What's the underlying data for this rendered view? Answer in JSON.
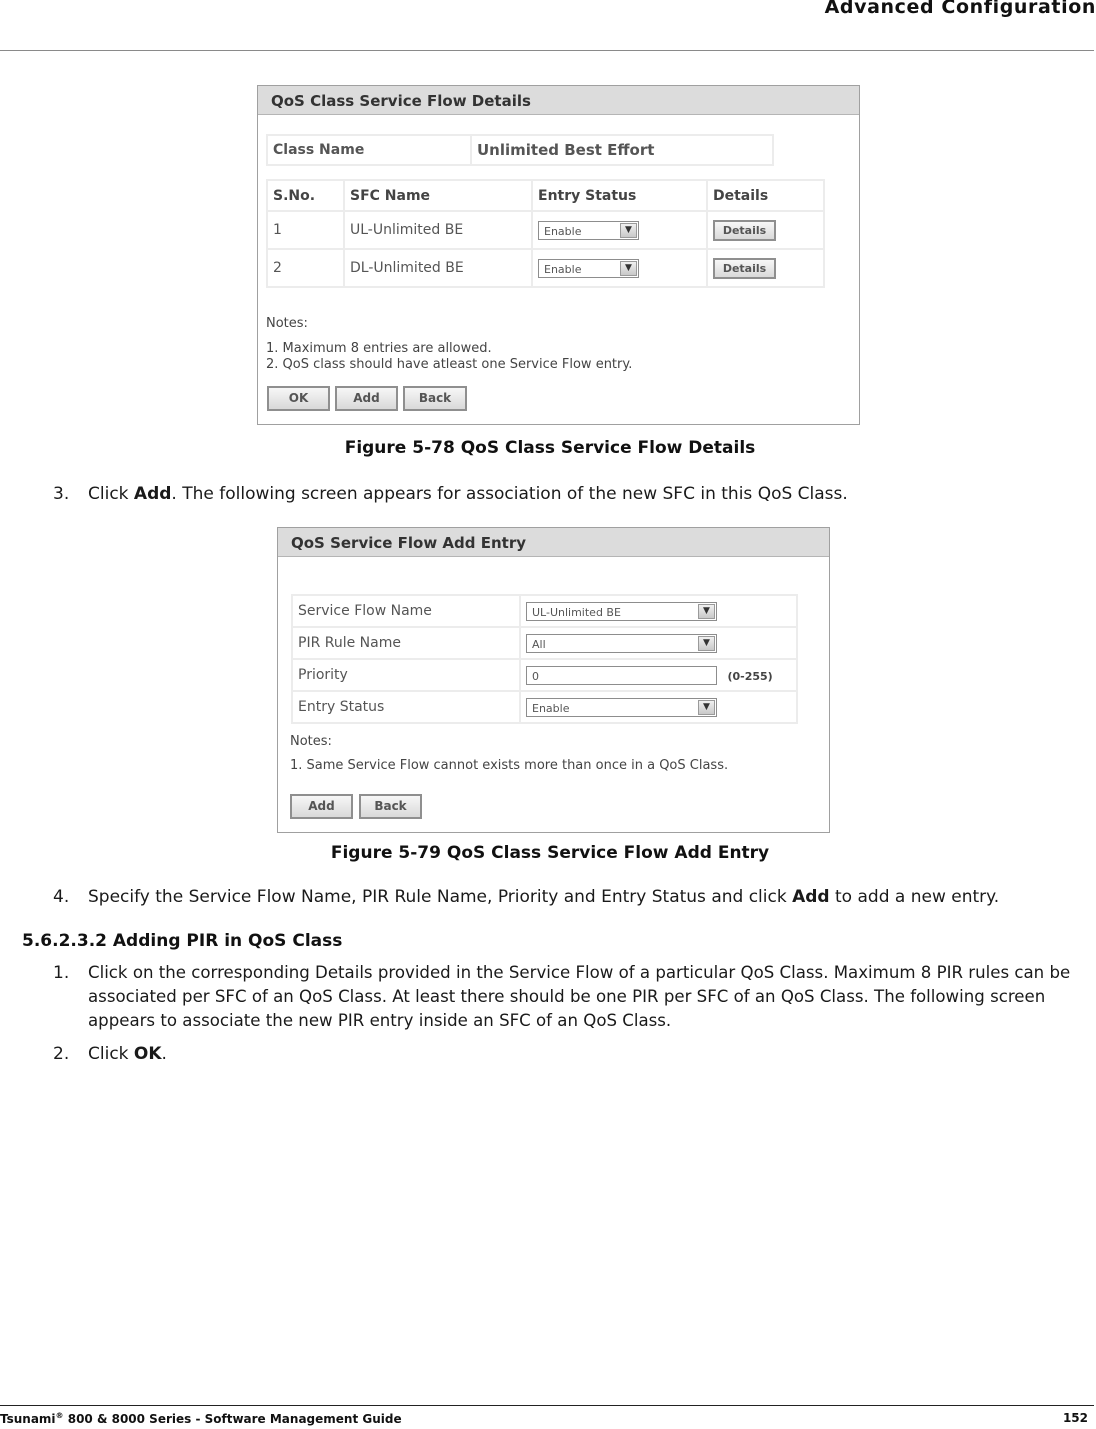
{
  "header": {
    "title": "Advanced Configuration"
  },
  "footer": {
    "guide_prefix": "Tsunami",
    "guide_reg": "®",
    "guide_suffix": " 800 & 8000 Series - Software Management Guide",
    "page_number": "152"
  },
  "figure1": {
    "panel_title": "QoS Class Service Flow Details",
    "class_name_label": "Class Name",
    "class_name_value": "Unlimited Best Effort",
    "columns": [
      "S.No.",
      "SFC Name",
      "Entry Status",
      "Details"
    ],
    "rows": [
      {
        "sno": "1",
        "sfc_name": "UL-Unlimited BE",
        "entry_status": "Enable",
        "details_button": "Details"
      },
      {
        "sno": "2",
        "sfc_name": "DL-Unlimited BE",
        "entry_status": "Enable",
        "details_button": "Details"
      }
    ],
    "notes_label": "Notes:",
    "notes": [
      "1. Maximum 8 entries are allowed.",
      "2. QoS class should have atleast one Service Flow entry."
    ],
    "buttons": {
      "ok": "OK",
      "add": "Add",
      "back": "Back"
    },
    "caption": "Figure 5-78 QoS Class Service Flow Details"
  },
  "step3": {
    "num": "3.",
    "pre": "Click ",
    "bold": "Add",
    "post": ". The following screen appears for association of the new SFC in this QoS Class."
  },
  "figure2": {
    "panel_title": "QoS Service Flow Add Entry",
    "fields": {
      "service_flow_name": {
        "label": "Service Flow Name",
        "value": "UL-Unlimited BE"
      },
      "pir_rule_name": {
        "label": "PIR Rule Name",
        "value": "All"
      },
      "priority": {
        "label": "Priority",
        "value": "0",
        "hint": "(0-255)"
      },
      "entry_status": {
        "label": "Entry Status",
        "value": "Enable"
      }
    },
    "notes_label": "Notes:",
    "notes": [
      "1.  Same Service Flow cannot exists more than once in a QoS Class."
    ],
    "buttons": {
      "add": "Add",
      "back": "Back"
    },
    "caption": "Figure 5-79 QoS Class Service Flow Add Entry"
  },
  "step4": {
    "num": "4.",
    "pre": "Specify the Service Flow Name, PIR Rule Name, Priority and Entry Status and click ",
    "bold": "Add",
    "post": " to add a new entry."
  },
  "section": {
    "heading": "5.6.2.3.2 Adding PIR in QoS Class"
  },
  "pir_step1": {
    "num": "1.",
    "text": "Click on the corresponding Details provided in the Service Flow of a particular QoS Class. Maximum 8 PIR rules can be associated per SFC of an QoS Class. At least there should be one PIR per SFC of an QoS Class. The following screen appears to associate the new PIR entry inside an SFC of an QoS Class."
  },
  "pir_step2": {
    "num": "2.",
    "pre": "Click ",
    "bold": "OK",
    "post": "."
  },
  "icons": {
    "dropdown": "chevron-down-icon"
  }
}
